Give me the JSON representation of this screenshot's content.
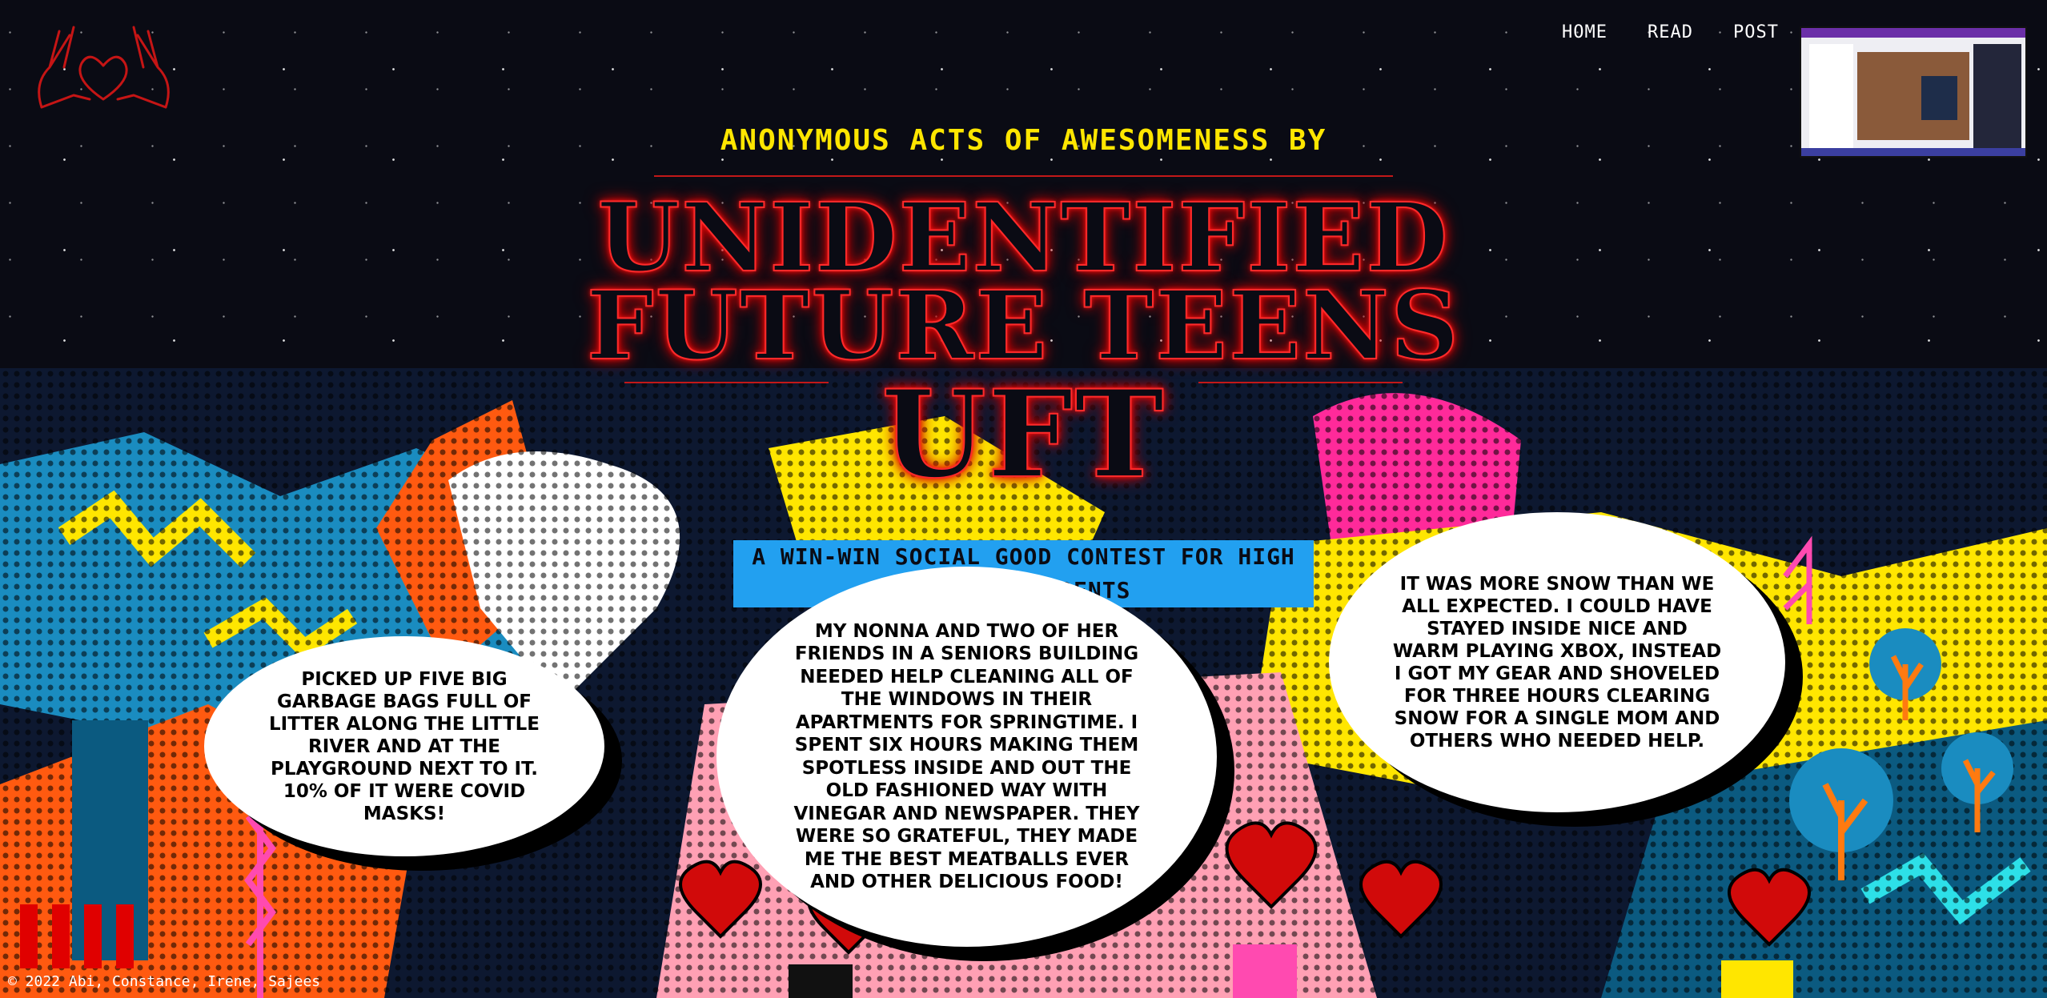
{
  "nav": {
    "home": "HOME",
    "read": "READ",
    "post": "POST"
  },
  "hero": {
    "pre_title": "ANONYMOUS ACTS OF AWESOMENESS BY",
    "title_line1": "UNIDENTIFIED",
    "title_line2": "FUTURE TEENS",
    "title_abbrev": "UFT",
    "banner": "A WIN-WIN SOCIAL GOOD CONTEST FOR HIGH SCHOOL STUDENTS"
  },
  "bubbles": [
    "Picked up five big garbage bags full of litter along the little river and at the playground next to it. 10% of it were covid masks!",
    "My Nonna and two of her friends in a seniors building needed help cleaning all of the windows in their apartments for springtime. I spent six hours making them spotless inside and out the old fashioned way with vinegar and newspaper. They were so grateful, they made me the best meatballs ever and other delicious food!",
    "It was more snow than we all expected. I could have stayed inside nice and warm playing Xbox, instead I got my gear and shoveled for three hours clearing snow for a single mom and others who needed help."
  ],
  "footer": "© 2022 Abi, Constance, Irene, Sajees",
  "colors": {
    "accent_yellow": "#ffe600",
    "neon_red": "#ff1a1a",
    "banner_blue": "#22a0f0"
  },
  "icons": {
    "logo": "heart-hands-icon"
  }
}
